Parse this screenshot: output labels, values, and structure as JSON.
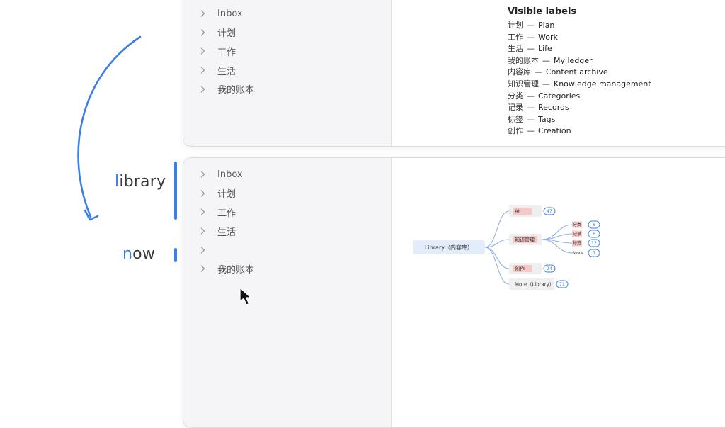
{
  "annotations": {
    "word1": {
      "first": "l",
      "rest": "ibrary"
    },
    "word2": {
      "first": "n",
      "rest": "ow"
    }
  },
  "top_window": {
    "sidebar_items": [
      "Inbox",
      "计划",
      "工作",
      "生活",
      "我的账本"
    ],
    "labels_title": "Visible labels",
    "labels": [
      {
        "zh": "计划",
        "en": "Plan"
      },
      {
        "zh": "工作",
        "en": "Work"
      },
      {
        "zh": "生活",
        "en": "Life"
      },
      {
        "zh": "我的账本",
        "en": "My ledger"
      },
      {
        "zh": "内容库",
        "en": "Content archive"
      },
      {
        "zh": "知识管理",
        "en": "Knowledge management"
      },
      {
        "zh": "分类",
        "en": "Categories"
      },
      {
        "zh": "记录",
        "en": "Records"
      },
      {
        "zh": "标签",
        "en": "Tags"
      },
      {
        "zh": "创作",
        "en": "Creation"
      }
    ],
    "label_separator": "—"
  },
  "bottom_window": {
    "sidebar_items": [
      "Inbox",
      "计划",
      "工作",
      "生活",
      "",
      "我的账本"
    ],
    "mindmap": {
      "root": "Library（内容库）",
      "branches": [
        {
          "label": "AI",
          "count": "47"
        },
        {
          "label": "知识管理",
          "count": "",
          "children": [
            {
              "label": "分类",
              "count": "6"
            },
            {
              "label": "记录",
              "count": "6"
            },
            {
              "label": "标签",
              "count": "12"
            },
            {
              "label": "More",
              "count": "7"
            }
          ]
        },
        {
          "label": "创作",
          "count": "24"
        },
        {
          "label": "More（Library）",
          "count": "71"
        }
      ]
    }
  },
  "colors": {
    "accent": "#3b7ee6",
    "sidebar_bg": "#f5f5f7",
    "root_node_bg": "#e3ecfb",
    "highlight_bg": "#f6c8c8",
    "branch_line": "#8fb2ea"
  }
}
